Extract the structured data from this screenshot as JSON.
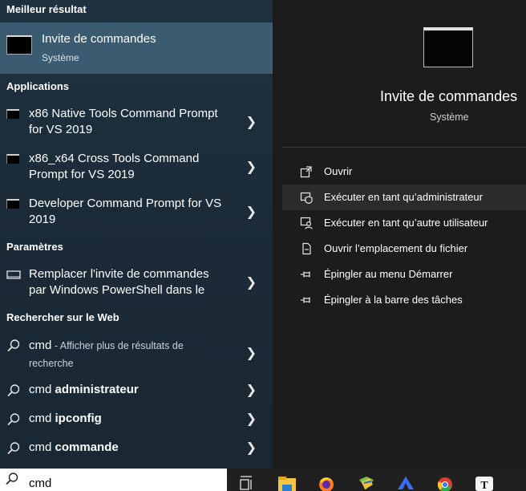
{
  "left": {
    "best_section": "Meilleur résultat",
    "best": {
      "title": "Invite de commandes",
      "subtitle": "Système"
    },
    "apps_section": "Applications",
    "apps": [
      {
        "label": "x86 Native Tools Command Prompt for VS 2019"
      },
      {
        "label": "x86_x64 Cross Tools Command Prompt for VS 2019"
      },
      {
        "label": "Developer Command Prompt for VS 2019"
      }
    ],
    "settings_section": "Paramètres",
    "settings": [
      {
        "label": "Remplacer l'invite de commandes par Windows PowerShell dans le"
      }
    ],
    "web_section": "Rechercher sur le Web",
    "web": [
      {
        "query": "cmd",
        "suffix": " - Afficher plus de résultats de recherche"
      },
      {
        "query": "cmd ",
        "bold": "administrateur"
      },
      {
        "query": "cmd ",
        "bold": "ipconfig"
      },
      {
        "query": "cmd ",
        "bold": "commande"
      }
    ]
  },
  "right": {
    "title": "Invite de commandes",
    "subtitle": "Système",
    "actions": [
      {
        "label": "Ouvrir",
        "icon": "open-icon"
      },
      {
        "label": "Exécuter en tant qu’administrateur",
        "icon": "shield-icon"
      },
      {
        "label": "Exécuter en tant qu’autre utilisateur",
        "icon": "user-icon"
      },
      {
        "label": "Ouvrir l’emplacement du fichier",
        "icon": "file-location-icon"
      },
      {
        "label": "Épingler au menu Démarrer",
        "icon": "pin-icon"
      },
      {
        "label": "Épingler à la barre des tâches",
        "icon": "pin-icon"
      }
    ]
  },
  "search": {
    "value": "cmd"
  },
  "taskbar": {
    "icons": [
      "task-view-icon",
      "file-explorer-icon",
      "firefox-icon",
      "folder-app-icon",
      "vpn-icon",
      "chrome-icon",
      "typora-icon"
    ]
  },
  "colors": {
    "highlight": "#3b5b70",
    "right_bg": "#1c1c1c",
    "taskbar_bg": "#202020"
  }
}
